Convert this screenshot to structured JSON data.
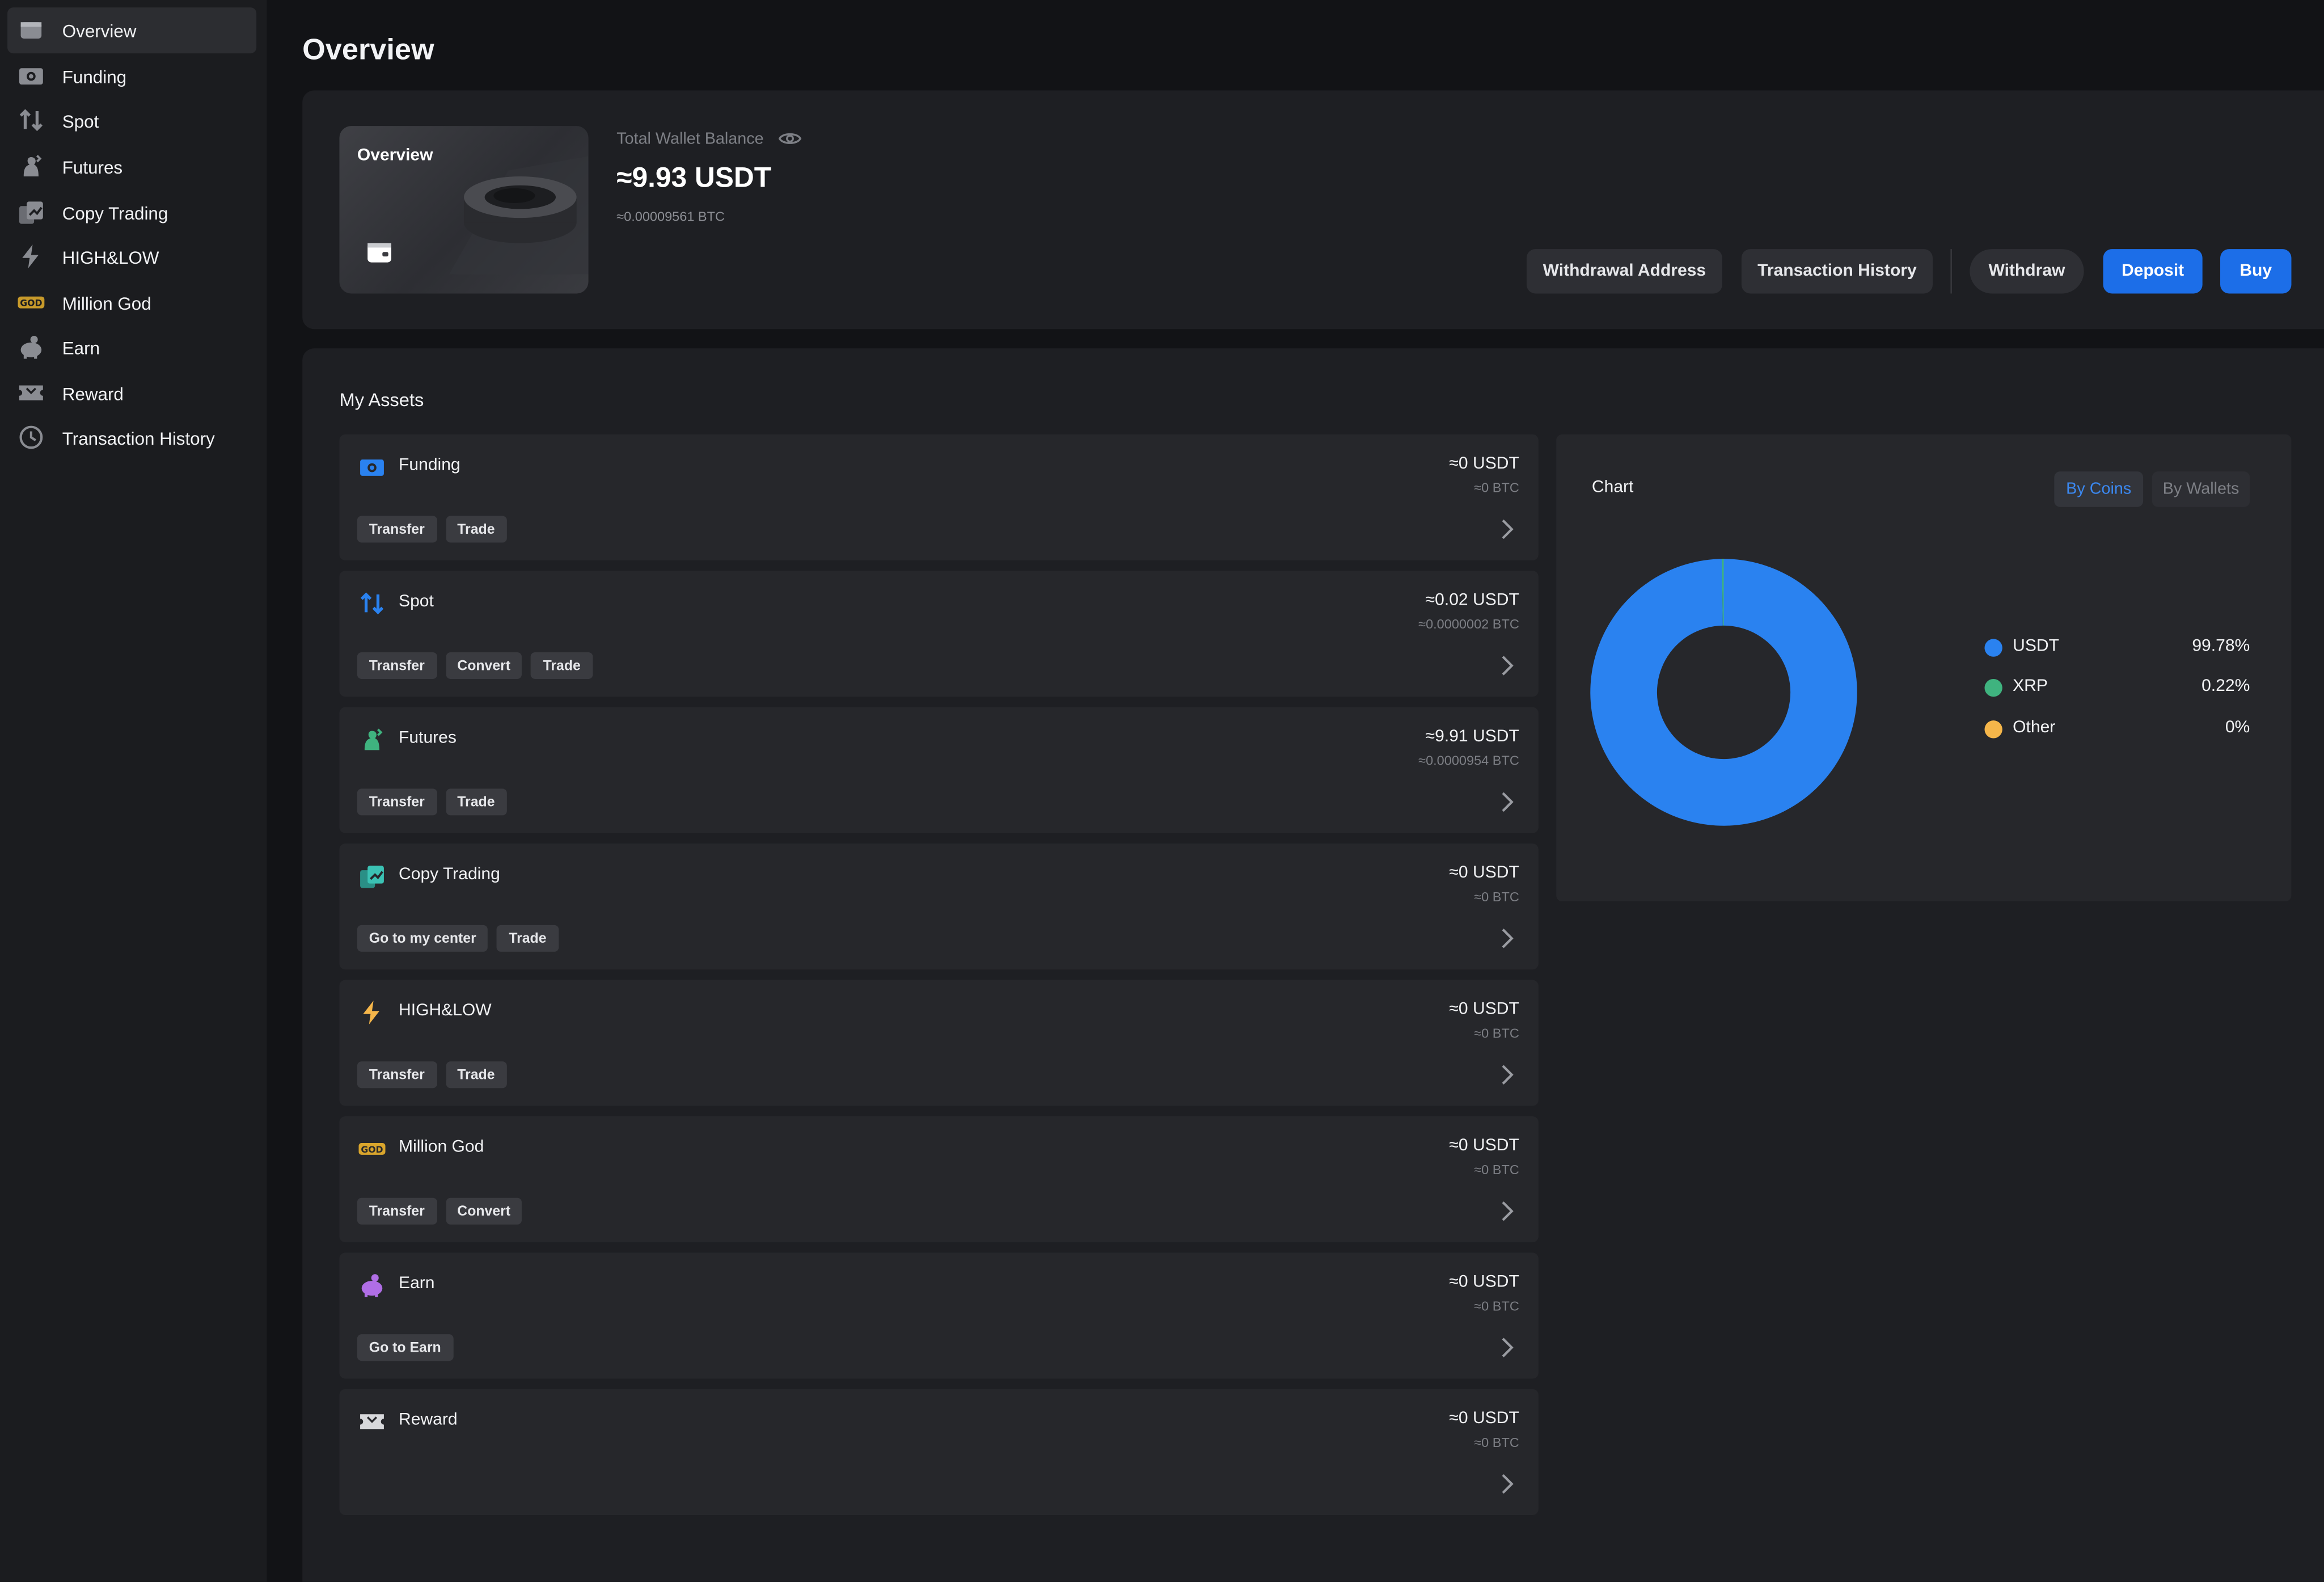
{
  "sidebar": {
    "items": [
      {
        "label": "Overview",
        "icon": "wallet-icon",
        "active": true
      },
      {
        "label": "Funding",
        "icon": "funding-icon"
      },
      {
        "label": "Spot",
        "icon": "spot-arrows-icon"
      },
      {
        "label": "Futures",
        "icon": "futures-icon"
      },
      {
        "label": "Copy Trading",
        "icon": "copy-trading-icon"
      },
      {
        "label": "HIGH&LOW",
        "icon": "lightning-icon"
      },
      {
        "label": "Million God",
        "icon": "million-god-icon"
      },
      {
        "label": "Earn",
        "icon": "piggy-bank-icon"
      },
      {
        "label": "Reward",
        "icon": "ticket-icon"
      },
      {
        "label": "Transaction History",
        "icon": "clock-icon"
      }
    ]
  },
  "header": {
    "title": "Overview"
  },
  "summary": {
    "card_title": "Overview",
    "total_label": "Total Wallet Balance",
    "total_value": "≈9.93 USDT",
    "total_btc": "≈0.00009561 BTC"
  },
  "actions": {
    "withdrawal_address": "Withdrawal Address",
    "transaction_history": "Transaction History",
    "withdraw": "Withdraw",
    "deposit": "Deposit",
    "buy": "Buy"
  },
  "assets": {
    "title": "My Assets",
    "items": [
      {
        "name": "Funding",
        "icon": "funding-icon",
        "usdt": "≈0 USDT",
        "btc": "≈0 BTC",
        "tags": [
          "Transfer",
          "Trade"
        ]
      },
      {
        "name": "Spot",
        "icon": "spot-arrows-icon",
        "usdt": "≈0.02 USDT",
        "btc": "≈0.0000002 BTC",
        "tags": [
          "Transfer",
          "Convert",
          "Trade"
        ]
      },
      {
        "name": "Futures",
        "icon": "futures-icon",
        "usdt": "≈9.91 USDT",
        "btc": "≈0.0000954 BTC",
        "tags": [
          "Transfer",
          "Trade"
        ]
      },
      {
        "name": "Copy Trading",
        "icon": "copy-trading-icon",
        "usdt": "≈0 USDT",
        "btc": "≈0 BTC",
        "tags": [
          "Go to my center",
          "Trade"
        ]
      },
      {
        "name": "HIGH&LOW",
        "icon": "lightning-icon",
        "usdt": "≈0 USDT",
        "btc": "≈0 BTC",
        "tags": [
          "Transfer",
          "Trade"
        ]
      },
      {
        "name": "Million God",
        "icon": "million-god-icon",
        "usdt": "≈0 USDT",
        "btc": "≈0 BTC",
        "tags": [
          "Transfer",
          "Convert"
        ]
      },
      {
        "name": "Earn",
        "icon": "piggy-bank-icon",
        "usdt": "≈0 USDT",
        "btc": "≈0 BTC",
        "tags": [
          "Go to Earn"
        ]
      },
      {
        "name": "Reward",
        "icon": "ticket-icon",
        "usdt": "≈0 USDT",
        "btc": "≈0 BTC",
        "tags": []
      }
    ]
  },
  "chart_panel": {
    "title": "Chart",
    "toggle_coins": "By Coins",
    "toggle_wallets": "By Wallets"
  },
  "chart_data": {
    "type": "pie",
    "donut": true,
    "categories": [
      "USDT",
      "XRP",
      "Other"
    ],
    "values": [
      99.78,
      0.22,
      0
    ],
    "labels": [
      "99.78%",
      "0.22%",
      "0%"
    ],
    "colors": [
      "#2a82f0",
      "#3fb37f",
      "#f5b64a"
    ]
  },
  "colors": {
    "accent": "#1c6ee8",
    "background": "#121316",
    "panel": "#1e1f23",
    "card": "#26272b"
  }
}
